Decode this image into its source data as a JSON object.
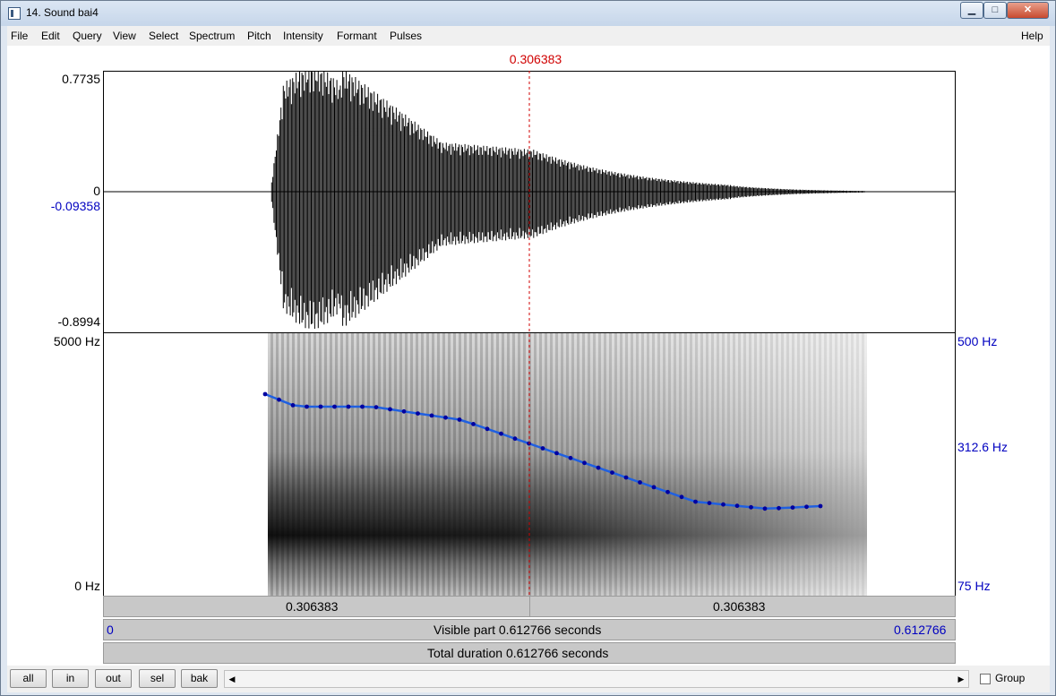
{
  "window": {
    "title": "14. Sound bai4"
  },
  "caption_buttons": {
    "minimize": "▁",
    "maximize": "□",
    "close": "✕"
  },
  "menu": [
    "File",
    "Edit",
    "Query",
    "View",
    "Select",
    "Spectrum",
    "Pitch",
    "Intensity",
    "Formant",
    "Pulses"
  ],
  "help_label": "Help",
  "cursor_time": "0.306383",
  "waveform": {
    "max_label": "0.7735",
    "zero_label": "0",
    "cursor_value_label": "-0.09358",
    "min_label": "-0.8994"
  },
  "spectrogram": {
    "top_freq": "5000 Hz",
    "bottom_freq": "0 Hz"
  },
  "pitch_axis": {
    "top": "500 Hz",
    "current": "312.6 Hz",
    "bottom": "75 Hz"
  },
  "time_bars": {
    "left_segment": "0.306383",
    "right_segment": "0.306383",
    "visible_start": "0",
    "visible_label": "Visible part 0.612766 seconds",
    "visible_end": "0.612766",
    "total_label": "Total duration 0.612766 seconds"
  },
  "nav_buttons": [
    "all",
    "in",
    "out",
    "sel",
    "bak"
  ],
  "scroll_arrows": {
    "left": "◀",
    "right": "▶"
  },
  "group_label": "Group",
  "colors": {
    "cursor": "#d00000",
    "axis_blue": "#0000c0",
    "pitch_curve": "#2060e0",
    "pitch_points": "#0000a0"
  },
  "icons": [
    "window-icon",
    "minimize-icon",
    "maximize-icon",
    "close-icon",
    "scroll-left-icon",
    "scroll-right-icon"
  ]
}
